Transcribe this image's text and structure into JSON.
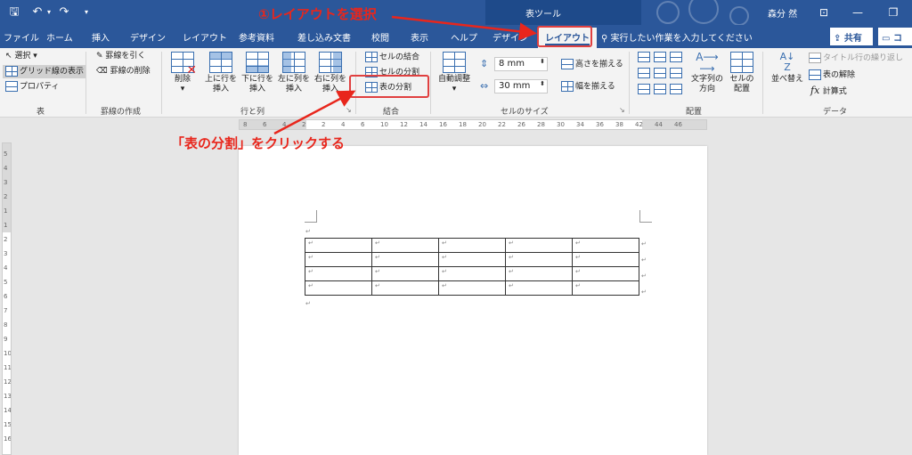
{
  "title_bar": {
    "context_tab_group": "表ツール",
    "user_name": "森分 然",
    "icons": [
      "save-icon",
      "undo-icon",
      "redo-icon",
      "customize-qat-icon"
    ]
  },
  "tabs": [
    "ファイル",
    "ホーム",
    "挿入",
    "デザイン",
    "レイアウト",
    "参考資料",
    "差し込み文書",
    "校閲",
    "表示",
    "ヘルプ",
    "デザイン",
    "レイアウト"
  ],
  "active_tab": "レイアウト",
  "tell_me": "実行したい作業を入力してください",
  "share": "共有",
  "comment": "コメ",
  "ribbon": {
    "table_group": {
      "label": "表",
      "select": "選択",
      "gridlines": "グリッド線の表示",
      "properties": "プロパティ"
    },
    "draw_group": {
      "label": "罫線の作成",
      "draw": "罫線を引く",
      "erase": "罫線の削除"
    },
    "rows_cols_group": {
      "label": "行と列",
      "delete": "削除",
      "insert_above_1": "上に行を",
      "insert_above_2": "挿入",
      "insert_below_1": "下に行を",
      "insert_below_2": "挿入",
      "insert_left_1": "左に列を",
      "insert_left_2": "挿入",
      "insert_right_1": "右に列を",
      "insert_right_2": "挿入"
    },
    "merge_group": {
      "label": "結合",
      "merge_cells": "セルの結合",
      "split_cells": "セルの分割",
      "split_table": "表の分割"
    },
    "cell_size_group": {
      "label": "セルのサイズ",
      "autofit": "自動調整",
      "height_value": "8 mm",
      "width_value": "30 mm",
      "distribute_rows": "高さを揃える",
      "distribute_cols": "幅を揃える"
    },
    "alignment_group": {
      "label": "配置",
      "text_direction_1": "文字列の",
      "text_direction_2": "方向",
      "cell_margins_1": "セルの",
      "cell_margins_2": "配置"
    },
    "data_group": {
      "label": "データ",
      "sort": "並べ替え",
      "repeat_header": "タイトル行の繰り返し",
      "convert_to_text": "表の解除",
      "formula": "計算式"
    }
  },
  "annotations": {
    "step1": "①レイアウトを選択",
    "step2": "「表の分割」をクリックする"
  },
  "colors": {
    "ribbon_blue": "#2b579a",
    "annotation_red": "#e8261c"
  },
  "document": {
    "table": {
      "rows": [
        [
          "↵",
          "↵",
          "↵",
          "↵",
          "↵"
        ],
        [
          "↵",
          "↵",
          "↵",
          "↵",
          "↵"
        ],
        [
          "↵",
          "↵",
          "↵",
          "↵",
          "↵"
        ],
        [
          "↵",
          "↵",
          "↵",
          "↵",
          "↵"
        ]
      ]
    },
    "paragraph_mark": "↵"
  },
  "ruler": {
    "h_ticks": [
      "8",
      "6",
      "4",
      "2",
      "2",
      "4",
      "6",
      "10",
      "12",
      "14",
      "16",
      "18",
      "20",
      "22",
      "26",
      "28",
      "30",
      "34",
      "36",
      "38",
      "42",
      "44",
      "46"
    ],
    "v_ticks": [
      "5",
      "4",
      "3",
      "2",
      "1",
      "1",
      "2",
      "3",
      "4",
      "5",
      "6",
      "7",
      "8",
      "9",
      "10",
      "11",
      "12",
      "13",
      "14",
      "15",
      "16"
    ]
  }
}
